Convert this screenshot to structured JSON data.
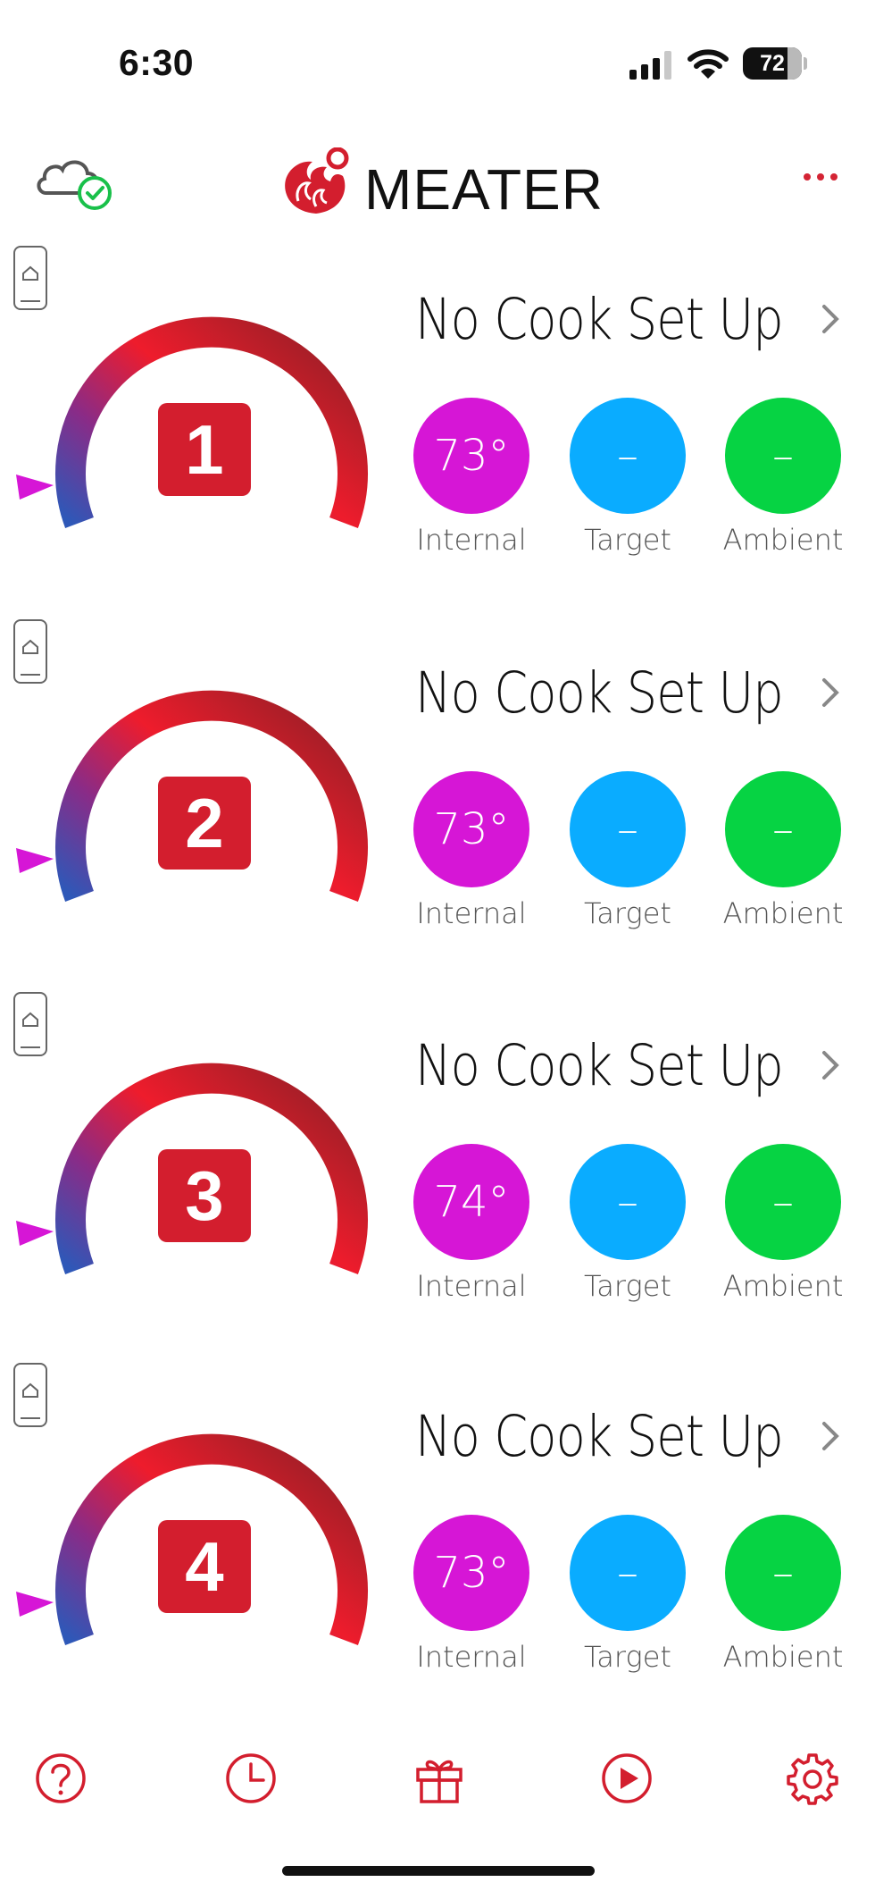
{
  "status_bar": {
    "time": "6:30",
    "battery": "72"
  },
  "header": {
    "brand": "MEATER"
  },
  "colors": {
    "accent": "#d31e2e",
    "internal": "#d616d6",
    "target": "#0aacff",
    "ambient": "#06d343"
  },
  "probes": [
    {
      "number": "1",
      "title": "No Cook Set Up",
      "internal": "73°",
      "target": "–",
      "ambient": "–",
      "labels": {
        "internal": "Internal",
        "target": "Target",
        "ambient": "Ambient"
      }
    },
    {
      "number": "2",
      "title": "No Cook Set Up",
      "internal": "73°",
      "target": "–",
      "ambient": "–",
      "labels": {
        "internal": "Internal",
        "target": "Target",
        "ambient": "Ambient"
      }
    },
    {
      "number": "3",
      "title": "No Cook Set Up",
      "internal": "74°",
      "target": "–",
      "ambient": "–",
      "labels": {
        "internal": "Internal",
        "target": "Target",
        "ambient": "Ambient"
      }
    },
    {
      "number": "4",
      "title": "No Cook Set Up",
      "internal": "73°",
      "target": "–",
      "ambient": "–",
      "labels": {
        "internal": "Internal",
        "target": "Target",
        "ambient": "Ambient"
      }
    }
  ],
  "tab_bar": [
    "help-icon",
    "history-clock-icon",
    "gift-icon",
    "play-icon",
    "settings-gear-icon"
  ]
}
